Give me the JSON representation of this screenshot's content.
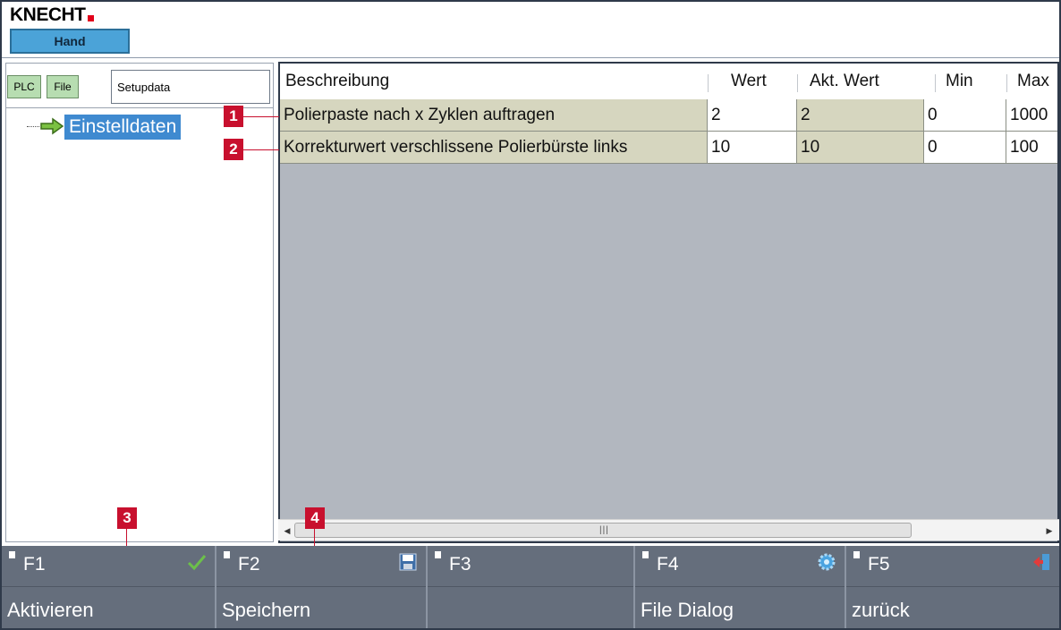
{
  "header": {
    "brand": "KNECHT",
    "mode": "Hand"
  },
  "left_panel": {
    "plc_label": "PLC",
    "file_label": "File",
    "setup_value": "Setupdata",
    "tree_item": "Einstelldaten"
  },
  "table": {
    "columns": [
      "Beschreibung",
      "Wert",
      "Akt. Wert",
      "Min",
      "Max"
    ],
    "rows": [
      {
        "beschreibung": "Polierpaste nach x Zyklen auftragen",
        "wert": "2",
        "akt_wert": "2",
        "min": "0",
        "max": "1000"
      },
      {
        "beschreibung": "Korrekturwert verschlissene Polierbürste links",
        "wert": "10",
        "akt_wert": "10",
        "min": "0",
        "max": "100"
      }
    ]
  },
  "callouts": [
    "1",
    "2",
    "3",
    "4"
  ],
  "function_keys": [
    {
      "key": "F1",
      "action": "Aktivieren",
      "icon": "checkmark-icon"
    },
    {
      "key": "F2",
      "action": "Speichern",
      "icon": "save-icon"
    },
    {
      "key": "F3",
      "action": "",
      "icon": ""
    },
    {
      "key": "F4",
      "action": "File Dialog",
      "icon": "gear-icon"
    },
    {
      "key": "F5",
      "action": "zurück",
      "icon": "exit-icon"
    }
  ],
  "colors": {
    "accent_blue": "#4ba3d8",
    "tree_selection": "#3f8ad0",
    "callout_red": "#c8102e",
    "fkey_bg": "#656e7c",
    "table_cell_olive": "#d6d6bf",
    "table_bg": "#b2b7bf"
  }
}
